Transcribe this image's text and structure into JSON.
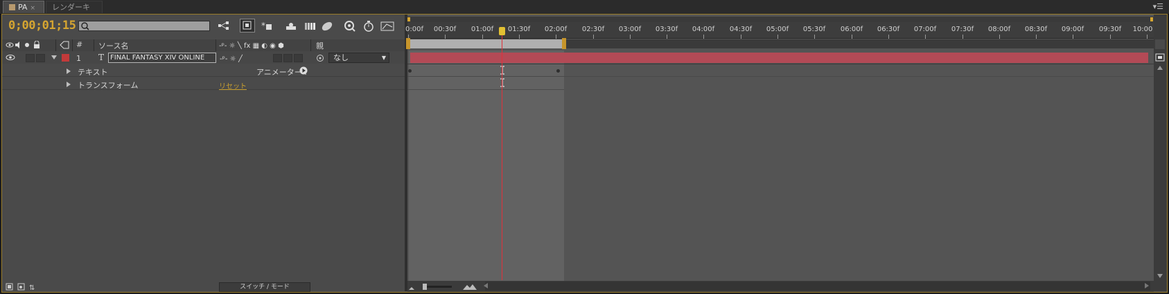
{
  "tabs": [
    {
      "label": "PA",
      "close": "×"
    },
    {
      "label": "レンダーキュー"
    }
  ],
  "panel_menu": "▾☰",
  "timecode": "0;00;01;15",
  "search": {
    "value": "",
    "placeholder": ""
  },
  "columns": {
    "hash": "#",
    "source_name": "ソース名",
    "parent": "親"
  },
  "layer": {
    "number": "1",
    "type_glyph": "T",
    "name": "FINAL FANTASY XIV ONLINE",
    "label_color": "#c23a3a",
    "parent": "なし"
  },
  "properties": [
    {
      "label": "テキスト",
      "extra": "アニメーター :"
    },
    {
      "label": "トランスフォーム",
      "extra": "リセット"
    }
  ],
  "bottom": {
    "switch_mode": "スイッチ / モード"
  },
  "ruler_labels": [
    "0:00f",
    "00:30f",
    "01:00f",
    "01:30f",
    "02:00f",
    "02:30f",
    "03:00f",
    "03:30f",
    "04:00f",
    "04:30f",
    "05:00f",
    "05:30f",
    "06:00f",
    "06:30f",
    "07:00f",
    "07:30f",
    "08:00f",
    "08:30f",
    "09:00f",
    "09:30f",
    "10:00"
  ],
  "colors": {
    "accent": "#d5a531",
    "layer_bar": "#b34a56",
    "cti": "#e0313a"
  }
}
